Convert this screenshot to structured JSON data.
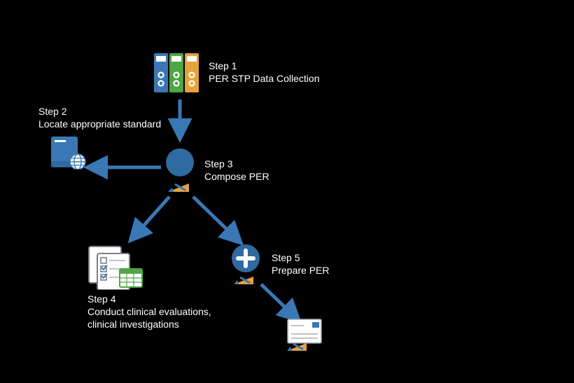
{
  "diagram": {
    "title": "",
    "nodes": {
      "step1": {
        "label_line1": "Step 1",
        "label_line2": "PER STP Data Collection"
      },
      "step2": {
        "label_line1": "Step 2",
        "label_line2": "Locate appropriate standard"
      },
      "step3": {
        "label_line1": "Step 3",
        "label_line2": "Compose PER"
      },
      "step4": {
        "label_line1": "Step 4",
        "label_line2": "Conduct clinical evaluations,",
        "label_line3": "clinical investigations"
      },
      "step5": {
        "label_line1": "Step 5",
        "label_line2": "Prepare PER"
      }
    },
    "icons": {
      "binders": "binders-icon",
      "book_globe": "book-globe-icon",
      "person_pencil": "person-pencil-icon",
      "checklist": "checklist-icon",
      "plus_pencil": "plus-pencil-icon",
      "letter_pencil": "letter-pencil-icon"
    },
    "colors": {
      "arrow": "#3a78b5",
      "blue": "#3a78b5",
      "green": "#4ea644",
      "orange": "#e6a23c",
      "gray": "#9aa0a6",
      "pencil_body": "#e6a23c",
      "pencil_lead": "#3a78b5"
    }
  }
}
